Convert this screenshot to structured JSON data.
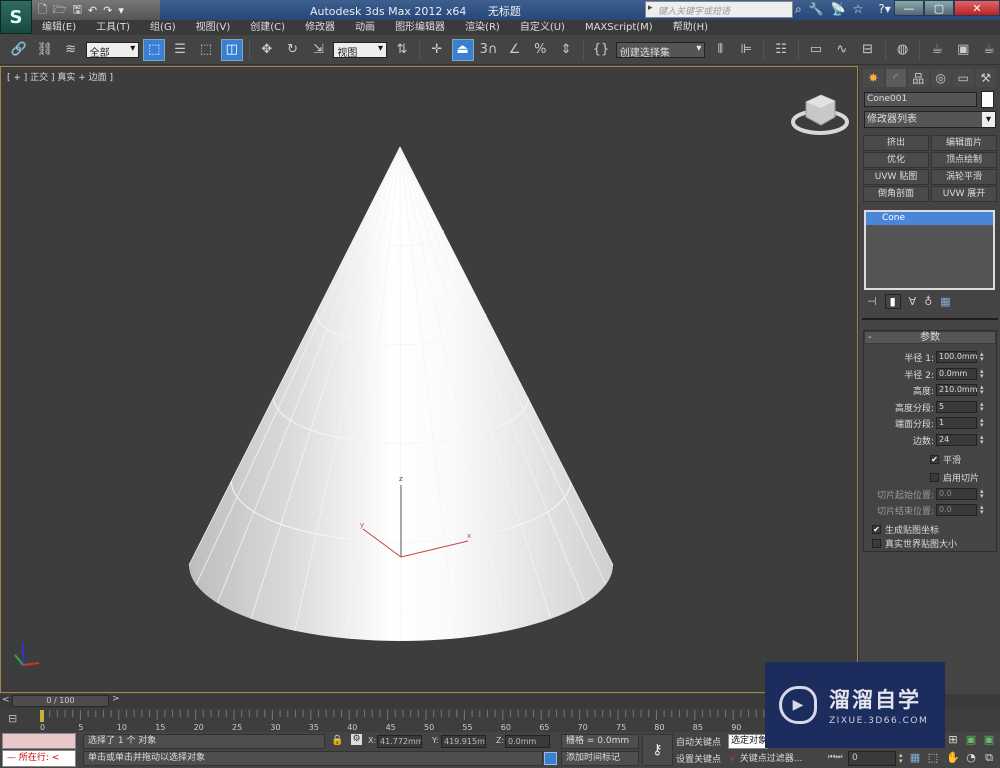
{
  "titlebar": {
    "app_title": "Autodesk 3ds Max  2012 x64",
    "doc_title": "无标题",
    "search_placeholder": "键入关键字或短语",
    "icons": [
      "binoculars-icon",
      "wrench-icon",
      "satellite-icon",
      "star-icon",
      "help-icon"
    ],
    "minimize": "—",
    "maximize": "▢",
    "close": "✕"
  },
  "qat": {
    "new": "🗋",
    "open": "🗁",
    "save": "🖫",
    "undo": "↶",
    "redo": "↷",
    "more": "▾"
  },
  "menu": [
    "编辑(E)",
    "工具(T)",
    "组(G)",
    "视图(V)",
    "创建(C)",
    "修改器",
    "动画",
    "图形编辑器",
    "渲染(R)",
    "自定义(U)",
    "MAXScript(M)",
    "帮助(H)"
  ],
  "toolbar": {
    "selection_filter": "全部",
    "ref_coord": "视图",
    "named_selection": "创建选择集",
    "snap_3": "3"
  },
  "viewport": {
    "label": "[ + ] 正交 ] 真实 + 边面 ]",
    "gizmo_axes": {
      "x": "x",
      "y": "y",
      "z": "z"
    },
    "object": {
      "type": "Cone",
      "sides": 24,
      "height_segments": 5
    }
  },
  "command_panel": {
    "tabs": [
      "create",
      "modify",
      "hierarchy",
      "motion",
      "display",
      "utilities"
    ],
    "object_name": "Cone001",
    "object_color": "#ffffff",
    "modifier_list": "修改器列表",
    "modifier_buttons": [
      "挤出",
      "编辑面片",
      "优化",
      "顶点绘制",
      "UVW 贴图",
      "涡轮平滑",
      "倒角剖面",
      "UVW 展开"
    ],
    "stack_items": [
      "Cone"
    ],
    "rollout_title": "参数",
    "params": [
      {
        "label": "半径 1:",
        "value": "100.0mm"
      },
      {
        "label": "半径 2:",
        "value": "0.0mm"
      },
      {
        "label": "高度:",
        "value": "210.0mm"
      },
      {
        "label": "高度分段:",
        "value": "5"
      },
      {
        "label": "端面分段:",
        "value": "1"
      },
      {
        "label": "边数:",
        "value": "24"
      }
    ],
    "smooth": {
      "label": "平滑",
      "checked": true
    },
    "slice_on": {
      "label": "启用切片",
      "checked": false
    },
    "slice_from": {
      "label": "切片起始位置:",
      "value": "0.0"
    },
    "slice_to": {
      "label": "切片结束位置:",
      "value": "0.0"
    },
    "gen_map_coords": {
      "label": "生成贴图坐标",
      "checked": true
    },
    "real_world_map": {
      "label": "真实世界贴图大小",
      "checked": false
    }
  },
  "timeline": {
    "slider_text": "0 / 100",
    "current_frame": 0,
    "total_frames": 100,
    "ticks": [
      "0",
      "5",
      "10",
      "15",
      "20",
      "25",
      "30",
      "35",
      "40",
      "45",
      "50",
      "55",
      "60",
      "65",
      "70",
      "75",
      "80",
      "85",
      "90"
    ]
  },
  "status": {
    "listener_label": "所在行:",
    "selection_msg": "选择了 1 个 对象",
    "prompt": "单击或单击并拖动以选择对象",
    "x_label": "X:",
    "x_value": "41.772mm",
    "y_label": "Y:",
    "y_value": "419.915mm",
    "z_label": "Z:",
    "z_value": "0.0mm",
    "grid": "栅格 = 0.0mm",
    "add_time_tag": "添加时间标记",
    "auto_key": "自动关键点",
    "set_key": "设置关键点",
    "selected_dropdown": "选定对象",
    "key_filters": "关键点过滤器...",
    "frame_value": "0"
  },
  "watermark": {
    "title": "溜溜自学",
    "url": "ZIXUE.3D66.COM"
  }
}
